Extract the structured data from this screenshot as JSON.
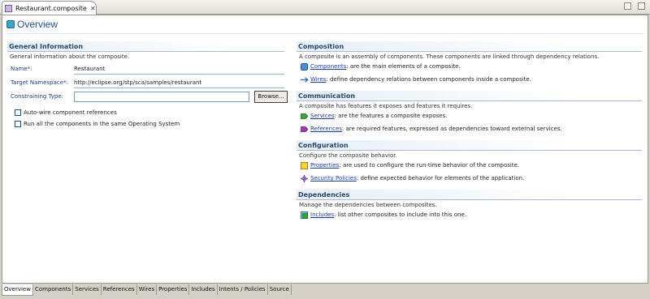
{
  "editor_tab": {
    "title": "Restaurant.composite",
    "close": "✕"
  },
  "header": {
    "title": "Overview"
  },
  "general": {
    "title": "General Information",
    "desc": "General information about the composite.",
    "name_label": "Name*:",
    "name_value": "Restaurant",
    "ns_label": "Target Namespace*:",
    "ns_value": "http://eclipse.org/stp/sca/samples/restaurant",
    "ctype_label": "Constraining Type:",
    "ctype_value": "",
    "browse": "Browse...",
    "autowire": "Auto-wire component references",
    "run_same_os": "Run all the components in the same Operating System"
  },
  "composition": {
    "title": "Composition",
    "desc": "A composite is an assembly of components. These components are linked through dependency relations.",
    "components_link": "Components",
    "components_text": ": are the main elements of a composite.",
    "wires_link": "Wires",
    "wires_text": ": define dependency relations between components inside a composite."
  },
  "communication": {
    "title": "Communication",
    "desc": "A composite has features it exposes and features it requires.",
    "services_link": "Services",
    "services_text": ": are the features a composite exposes.",
    "references_link": "References",
    "references_text": ": are required features, expressed as dependencies toward external services."
  },
  "configuration": {
    "title": "Configuration",
    "desc": "Configure the composite behavior.",
    "properties_link": "Properties",
    "properties_text": ": are used to configure the run-time behavior of the composite.",
    "policies_link": "Security Policies",
    "policies_text": ": define expected behavior for elements of the application."
  },
  "dependencies": {
    "title": "Dependencies",
    "desc": "Manage the dependencies between composites.",
    "includes_link": "Includes",
    "includes_text": ": list other composites to include into this one."
  },
  "bottom_tabs": [
    "Overview",
    "Components",
    "Services",
    "References",
    "Wires",
    "Properties",
    "Includes",
    "Intents / Policies",
    "Source"
  ]
}
